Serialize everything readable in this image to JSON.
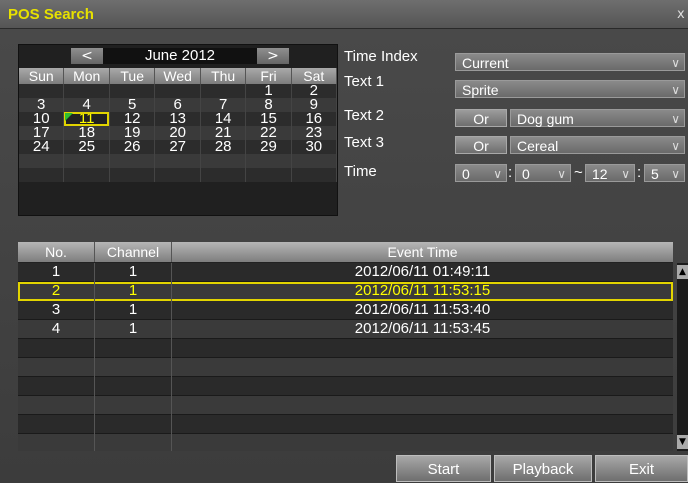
{
  "window": {
    "title": "POS Search",
    "close_label": "x"
  },
  "calendar": {
    "prev": "<",
    "next": ">",
    "month": "June 2012",
    "weekdays": [
      "Sun",
      "Mon",
      "Tue",
      "Wed",
      "Thu",
      "Fri",
      "Sat"
    ],
    "weeks": [
      [
        "",
        "",
        "",
        "",
        "",
        "1",
        "2"
      ],
      [
        "3",
        "4",
        "5",
        "6",
        "7",
        "8",
        "9"
      ],
      [
        "10",
        "11",
        "12",
        "13",
        "14",
        "15",
        "16"
      ],
      [
        "17",
        "18",
        "19",
        "20",
        "21",
        "22",
        "23"
      ],
      [
        "24",
        "25",
        "26",
        "27",
        "28",
        "29",
        "30"
      ],
      [
        "",
        "",
        "",
        "",
        "",
        "",
        ""
      ],
      [
        "",
        "",
        "",
        "",
        "",
        "",
        ""
      ]
    ],
    "selected_day": "11"
  },
  "form": {
    "time_index_label": "Time Index",
    "time_index_value": "Current",
    "text1_label": "Text 1",
    "text1_value": "Sprite",
    "text2_label": "Text 2",
    "text2_op": "Or",
    "text2_value": "Dog gum",
    "text3_label": "Text 3",
    "text3_op": "Or",
    "text3_value": "Cereal",
    "time_label": "Time",
    "time_from_h": "0",
    "time_from_m": "0",
    "time_to_h": "12",
    "time_to_m": "5",
    "sep_colon": ":",
    "sep_tilde": "~"
  },
  "table": {
    "headers": {
      "no": "No.",
      "channel": "Channel",
      "event_time": "Event Time"
    },
    "rows": [
      {
        "no": "1",
        "channel": "1",
        "event_time": "2012/06/11 01:49:11"
      },
      {
        "no": "2",
        "channel": "1",
        "event_time": "2012/06/11 11:53:15"
      },
      {
        "no": "3",
        "channel": "1",
        "event_time": "2012/06/11 11:53:40"
      },
      {
        "no": "4",
        "channel": "1",
        "event_time": "2012/06/11 11:53:45"
      }
    ],
    "selected_index": 2
  },
  "buttons": {
    "start": "Start",
    "playback": "Playback",
    "exit": "Exit"
  },
  "colors": {
    "title": "#e7e100",
    "selection": "#e2d400",
    "selected_text": "#ffff00",
    "marker": "#2fbf2f"
  }
}
